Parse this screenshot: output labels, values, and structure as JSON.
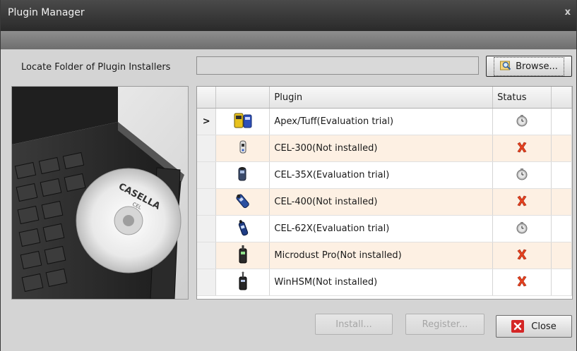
{
  "window": {
    "title": "Plugin Manager",
    "close_glyph": "x"
  },
  "locate": {
    "label": "Locate Folder of Plugin Installers",
    "path_value": "",
    "browse_label": "Browse..."
  },
  "image": {
    "cd_text": "CASELLA",
    "cd_subtext": "CEL"
  },
  "grid": {
    "columns": [
      "",
      "",
      "Plugin",
      "Status",
      ""
    ],
    "rows": [
      {
        "selected": true,
        "pointer": ">",
        "device_icon": "apex-tuff-device-icon",
        "name": "Apex/Tuff(Evaluation trial)",
        "status": "evaluation",
        "status_icon": "clock-icon"
      },
      {
        "selected": false,
        "pointer": "",
        "device_icon": "cel-300-device-icon",
        "name": "CEL-300(Not installed)",
        "status": "not-installed",
        "status_icon": "red-x-icon"
      },
      {
        "selected": false,
        "pointer": "",
        "device_icon": "cel-35x-device-icon",
        "name": "CEL-35X(Evaluation trial)",
        "status": "evaluation",
        "status_icon": "clock-icon"
      },
      {
        "selected": false,
        "pointer": "",
        "device_icon": "cel-400-device-icon",
        "name": "CEL-400(Not installed)",
        "status": "not-installed",
        "status_icon": "red-x-icon"
      },
      {
        "selected": false,
        "pointer": "",
        "device_icon": "cel-62x-device-icon",
        "name": "CEL-62X(Evaluation trial)",
        "status": "evaluation",
        "status_icon": "clock-icon"
      },
      {
        "selected": false,
        "pointer": "",
        "device_icon": "microdust-pro-device-icon",
        "name": "Microdust Pro(Not installed)",
        "status": "not-installed",
        "status_icon": "red-x-icon"
      },
      {
        "selected": false,
        "pointer": "",
        "device_icon": "winhsm-device-icon",
        "name": "WinHSM(Not installed)",
        "status": "not-installed",
        "status_icon": "red-x-icon"
      }
    ]
  },
  "buttons": {
    "install": "Install...",
    "register": "Register...",
    "close": "Close"
  },
  "colors": {
    "alt_row": "#fdf0e3",
    "red_x": "#e8421f",
    "title_bar": "#3a3a3a"
  }
}
